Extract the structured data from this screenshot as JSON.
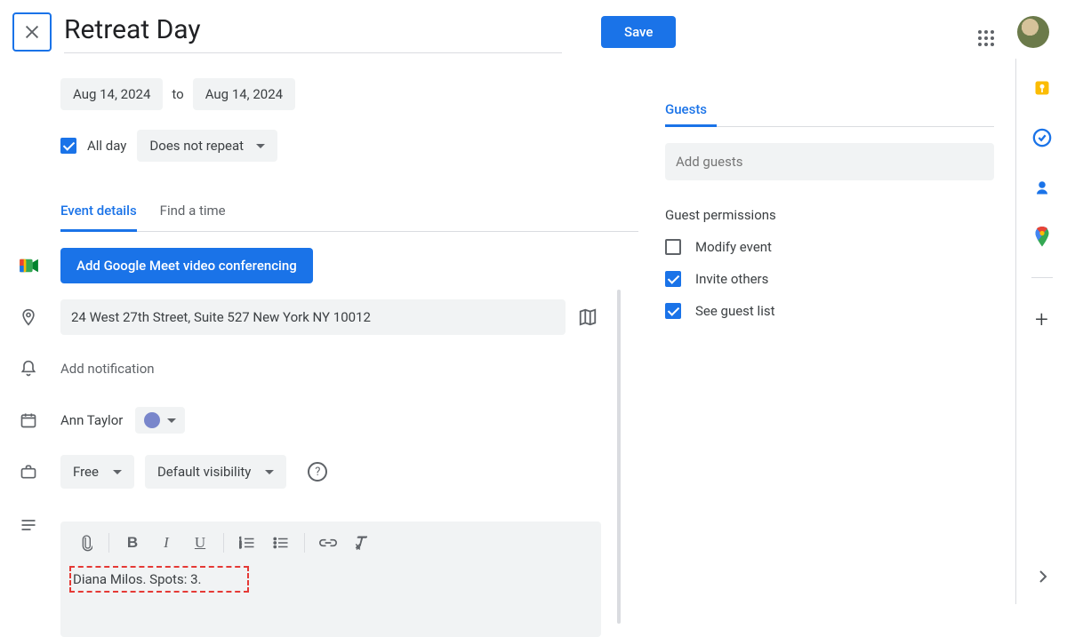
{
  "header": {
    "title": "Retreat Day",
    "save_label": "Save"
  },
  "dates": {
    "start": "Aug 14, 2024",
    "to_label": "to",
    "end": "Aug 14, 2024"
  },
  "allday": {
    "checked": true,
    "label": "All day",
    "repeat": "Does not repeat"
  },
  "tabs": {
    "details": "Event details",
    "findtime": "Find a time"
  },
  "meet": {
    "button": "Add Google Meet video conferencing"
  },
  "location": {
    "value": "24 West 27th Street, Suite 527 New York NY 10012"
  },
  "notification": {
    "label": "Add notification"
  },
  "owner": {
    "name": "Ann Taylor",
    "color": "#7986cb"
  },
  "availability": {
    "busy": "Free",
    "visibility": "Default visibility"
  },
  "description": {
    "text": "Diana Milos. Spots: 3."
  },
  "guests": {
    "header": "Guests",
    "placeholder": "Add guests",
    "permissions_title": "Guest permissions",
    "modify": {
      "label": "Modify event",
      "checked": false
    },
    "invite": {
      "label": "Invite others",
      "checked": true
    },
    "seelist": {
      "label": "See guest list",
      "checked": true
    }
  }
}
